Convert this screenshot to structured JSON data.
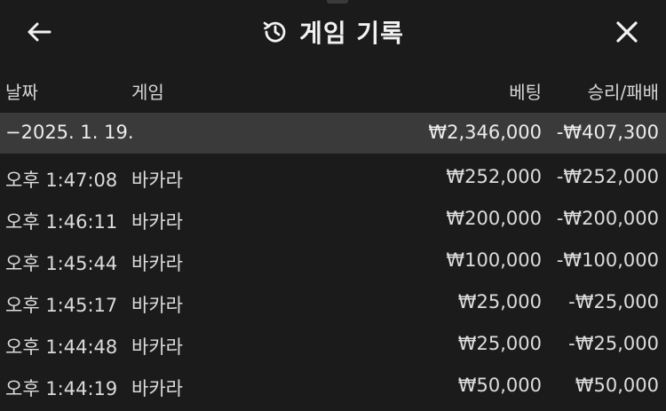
{
  "header": {
    "title": "게임 기록",
    "back_icon": "arrow-left-icon",
    "history_icon": "history-clock-icon",
    "close_icon": "close-icon"
  },
  "columns": {
    "date": "날짜",
    "game": "게임",
    "bet": "베팅",
    "result": "승리/패배"
  },
  "summary": {
    "date": "−2025. 1. 19.",
    "bet": "₩2,346,000",
    "result": "-₩407,300"
  },
  "rows": [
    {
      "time": "오후 1:47:08",
      "game": "바카라",
      "bet": "₩252,000",
      "result": "-₩252,000"
    },
    {
      "time": "오후 1:46:11",
      "game": "바카라",
      "bet": "₩200,000",
      "result": "-₩200,000"
    },
    {
      "time": "오후 1:45:44",
      "game": "바카라",
      "bet": "₩100,000",
      "result": "-₩100,000"
    },
    {
      "time": "오후 1:45:17",
      "game": "바카라",
      "bet": "₩25,000",
      "result": "-₩25,000"
    },
    {
      "time": "오후 1:44:48",
      "game": "바카라",
      "bet": "₩25,000",
      "result": "-₩25,000"
    },
    {
      "time": "오후 1:44:19",
      "game": "바카라",
      "bet": "₩50,000",
      "result": "₩50,000"
    }
  ]
}
